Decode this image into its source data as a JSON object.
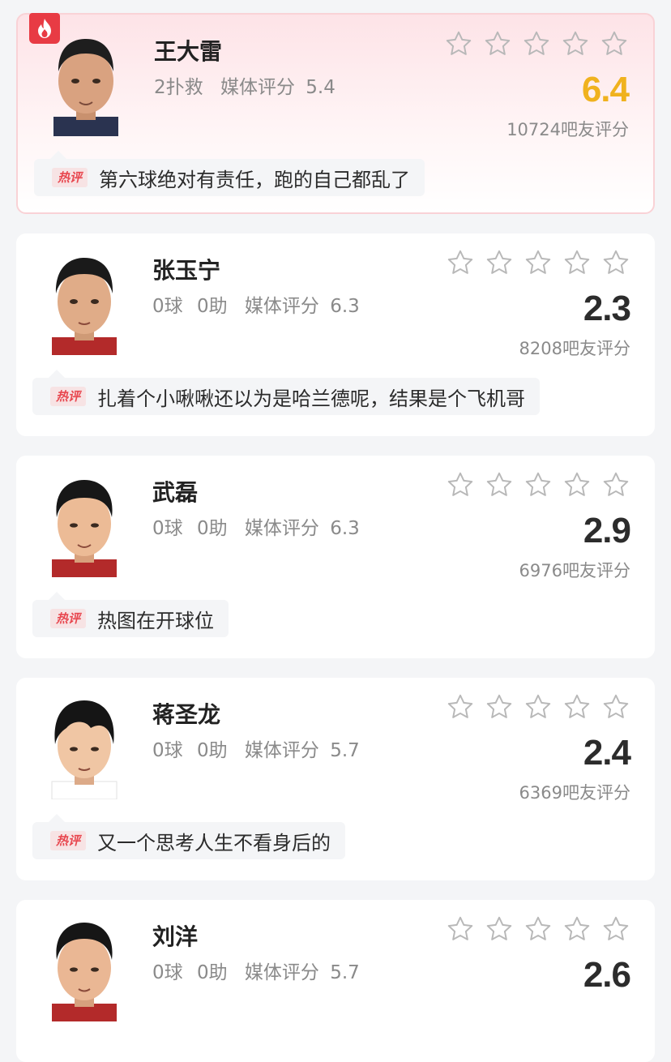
{
  "players": [
    {
      "name": "王大雷",
      "stat1": "2扑救",
      "stat2": "",
      "media_label": "媒体评分",
      "media_score": "5.4",
      "fan_score": "6.4",
      "votes": "10724",
      "votes_label": "吧友评分",
      "hot_label": "热评",
      "comment": "第六球绝对有责任，跑的自己都乱了",
      "highlight": true,
      "score_color": "#f0b21e"
    },
    {
      "name": "张玉宁",
      "stat1": "0球",
      "stat2": "0助",
      "media_label": "媒体评分",
      "media_score": "6.3",
      "fan_score": "2.3",
      "votes": "8208",
      "votes_label": "吧友评分",
      "hot_label": "热评",
      "comment": "扎着个小啾啾还以为是哈兰德呢，结果是个飞机哥"
    },
    {
      "name": "武磊",
      "stat1": "0球",
      "stat2": "0助",
      "media_label": "媒体评分",
      "media_score": "6.3",
      "fan_score": "2.9",
      "votes": "6976",
      "votes_label": "吧友评分",
      "hot_label": "热评",
      "comment": "热图在开球位"
    },
    {
      "name": "蒋圣龙",
      "stat1": "0球",
      "stat2": "0助",
      "media_label": "媒体评分",
      "media_score": "5.7",
      "fan_score": "2.4",
      "votes": "6369",
      "votes_label": "吧友评分",
      "hot_label": "热评",
      "comment": "又一个思考人生不看身后的"
    },
    {
      "name": "刘洋",
      "stat1": "0球",
      "stat2": "0助",
      "media_label": "媒体评分",
      "media_score": "5.7",
      "fan_score": "2.6",
      "votes": "",
      "votes_label": "",
      "hot_label": "",
      "comment": ""
    }
  ],
  "icons": {
    "star": "star-outline-icon",
    "flame": "flame-icon"
  },
  "colors": {
    "gold_score": "#f0b21e",
    "hot_red": "#e8474f",
    "badge_red": "#e83b44"
  }
}
